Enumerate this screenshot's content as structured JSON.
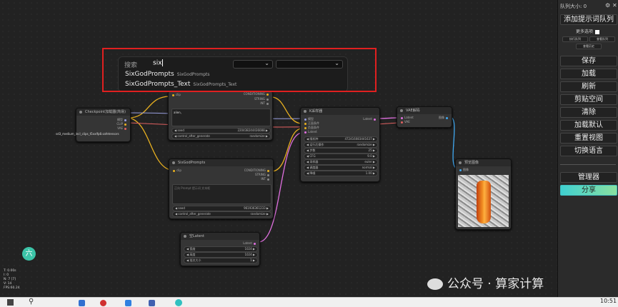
{
  "search": {
    "label": "搜索",
    "value": "six"
  },
  "results": [
    {
      "name": "SixGodPrompts",
      "category": "SixGodPrompts"
    },
    {
      "name": "SixGodPrompts_Text",
      "category": "SixGodPrompts_Text"
    }
  ],
  "nodes": {
    "checkpoint": {
      "title": "Checkpoint加载器(简易)",
      "outputs": [
        "模型",
        "CLIP",
        "VAE"
      ],
      "ckpt": "sd3_medium_incl_clips_t5xxlfp8.safetensors"
    },
    "sixgod1": {
      "clip": "clip",
      "outputs": [
        "CONDITIONING",
        "STRING",
        "INT"
      ],
      "text": "alien,",
      "seed_label": "seed",
      "seed": "220438244436088",
      "control_label": "control_after_generate",
      "control": "randomize"
    },
    "sixgod2": {
      "title": "SixGodPrompts",
      "clip": "clip",
      "outputs": [
        "CONDITIONING",
        "STRING",
        "INT"
      ],
      "text": "正向 Prompt 提示词 文本框",
      "seed_label": "seed",
      "seed": "961936361233",
      "control_label": "control_after_generate",
      "control": "randomize"
    },
    "ksampler": {
      "title": "K采样器",
      "inputs": [
        "模型",
        "正面条件",
        "负面条件",
        "Latent"
      ],
      "output": "Latent",
      "widgets": [
        [
          "随机种",
          "472416083441637"
        ],
        [
          "运行后操作",
          "randomize"
        ],
        [
          "步数",
          "25"
        ],
        [
          "CFG",
          "9.0"
        ],
        [
          "采样器",
          "euler"
        ],
        [
          "调度器",
          "normal"
        ],
        [
          "降噪",
          "1.00"
        ]
      ]
    },
    "vae": {
      "title": "VAE解码",
      "inputs": [
        "Latent",
        "VAE"
      ],
      "output": "图像"
    },
    "preview": {
      "title": "预览图像",
      "input": "图像"
    },
    "latent": {
      "title": "空Latent",
      "output": "Latent",
      "widgets": [
        [
          "宽度",
          "1024"
        ],
        [
          "高度",
          "1024"
        ],
        [
          "批次大小",
          "1"
        ]
      ]
    }
  },
  "panel": {
    "queue_size": "队列大小: 0",
    "add_queue": "添加提示词队列",
    "extra": "更多选项",
    "small": [
      "执行队列",
      "查看队列",
      "查看历史"
    ],
    "buttons": [
      "保存",
      "加载",
      "刷新",
      "剪贴空间",
      "清除",
      "加载默认",
      "重置视图",
      "切换语言"
    ],
    "manager": "管理器",
    "share": "分享"
  },
  "stats": [
    "T: 0.00s",
    "I: 0",
    "N: 7 [7]",
    "V: 14",
    "FPS:60.24"
  ],
  "logo_char": "六",
  "watermark": "公众号 · 算家计算",
  "clock": "10:51"
}
